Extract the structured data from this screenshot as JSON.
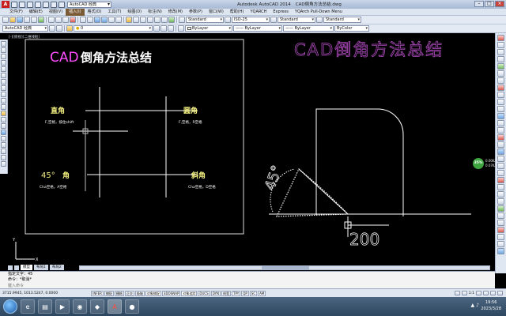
{
  "titlebar": {
    "workspace": "AutoCAD 经典",
    "app_name": "Autodesk AutoCAD 2014",
    "file_name": "CAD倒角方法总结.dwg"
  },
  "menubar": {
    "items": [
      "文件(F)",
      "编辑(E)",
      "视图(V)",
      "插入(I)",
      "格式(O)",
      "工具(T)",
      "绘图(D)",
      "标注(N)",
      "修改(M)",
      "参数(P)",
      "窗口(W)",
      "帮助(H)",
      "YQARCH",
      "Express",
      "YQArch Pull-Down Menu"
    ]
  },
  "toolbar1": {
    "text_style": "Standard",
    "dim_style": "ISO-25",
    "table_style": "Standard",
    "mleader_style": "Standard"
  },
  "toolbar2": {
    "workspace": "AutoCAD 经典",
    "layer": "0",
    "color": "ByLayer",
    "linetype": "ByLayer",
    "lineweight": "ByLayer",
    "plotstyle": "ByColor"
  },
  "viewport_label": "[-][俯视][二维线框]",
  "drawing": {
    "left_title_prefix": "CAD",
    "left_title_suffix": "倒角方法总结",
    "right_title": "CAD倒角方法总结",
    "straight_corner": "直角",
    "straight_note": "F,空格，按住shift",
    "round_corner": "圆角",
    "round_note": "F,空格，R空格",
    "angle_corner_num": "45°",
    "angle_corner_label": "角",
    "angle_note": "Cha空格，A空格",
    "bevel_corner": "斜角",
    "bevel_note": "Cha空格，D空格",
    "angle_dim": "45°",
    "length_dim": "200"
  },
  "netspeed": {
    "percent": "35%",
    "up": "0.00K/s",
    "down": "0.07K/s"
  },
  "tabs": [
    "模型",
    "布局1",
    "布局2"
  ],
  "command": {
    "history1": "指定文字：45",
    "history2": "命令：*取消*",
    "placeholder": "键入命令"
  },
  "statusbar": {
    "coords": "3715.9945, 1013.5247, 0.0000",
    "buttons": [
      "INFER",
      "捕捉",
      "栅格",
      "正交",
      "极轴",
      "对象捕捉",
      "3DOSNAP",
      "对象追踪",
      "DUCS",
      "DYN",
      "线宽",
      "TPY",
      "QP",
      "SC",
      "AM"
    ],
    "scale": "1:1"
  },
  "taskbar": {
    "time": "19:56",
    "date": "2023/3/28"
  }
}
